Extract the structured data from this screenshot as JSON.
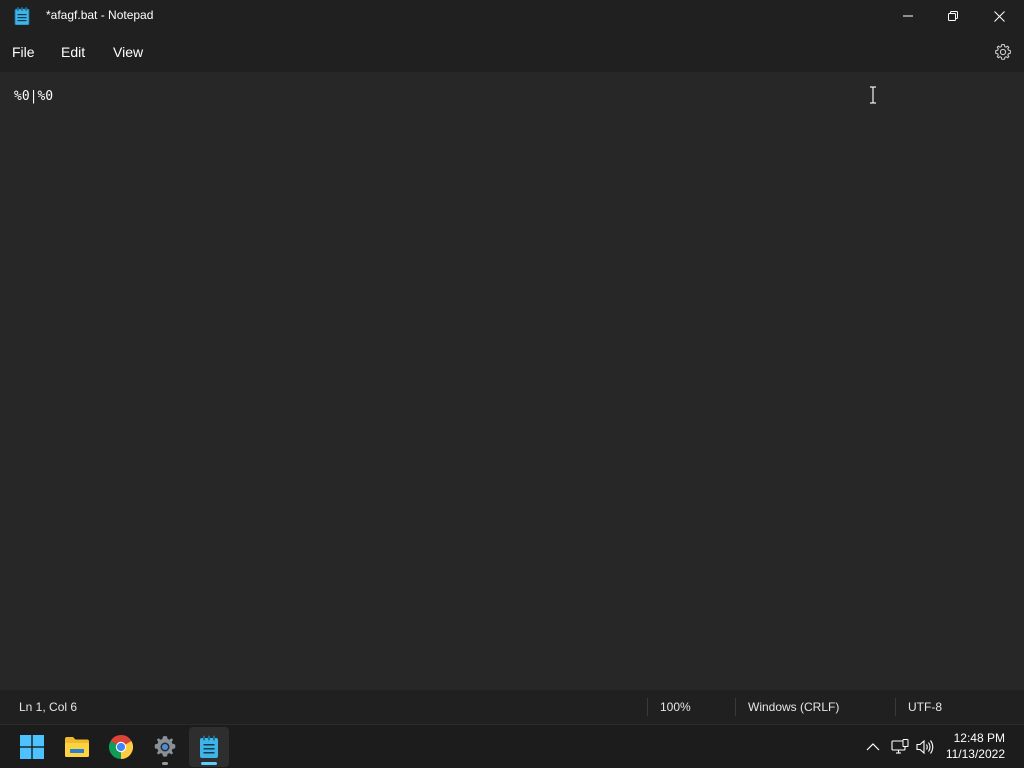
{
  "window": {
    "title": "*afagf.bat - Notepad",
    "app_icon": "notepad-icon"
  },
  "menu": {
    "items": [
      {
        "label": "File"
      },
      {
        "label": "Edit"
      },
      {
        "label": "View"
      }
    ],
    "settings_icon": "gear-icon"
  },
  "editor": {
    "content": "%0|%0"
  },
  "status": {
    "position": "Ln 1, Col 6",
    "zoom": "100%",
    "line_ending": "Windows (CRLF)",
    "encoding": "UTF-8"
  },
  "taskbar": {
    "apps": [
      {
        "name": "start",
        "icon": "windows-logo-icon"
      },
      {
        "name": "file-explorer",
        "icon": "folder-icon"
      },
      {
        "name": "chrome",
        "icon": "chrome-icon"
      },
      {
        "name": "settings",
        "icon": "gear-icon"
      },
      {
        "name": "notepad",
        "icon": "notepad-icon",
        "active": true
      }
    ],
    "tray": {
      "icons": [
        "chevron-up-icon",
        "network-icon",
        "volume-icon"
      ]
    },
    "clock": {
      "time": "12:48 PM",
      "date": "11/13/2022"
    }
  },
  "colors": {
    "accent": "#60cdff",
    "titlebar_bg": "#202020",
    "editor_bg": "#272727",
    "taskbar_bg": "#1c1c1c"
  }
}
